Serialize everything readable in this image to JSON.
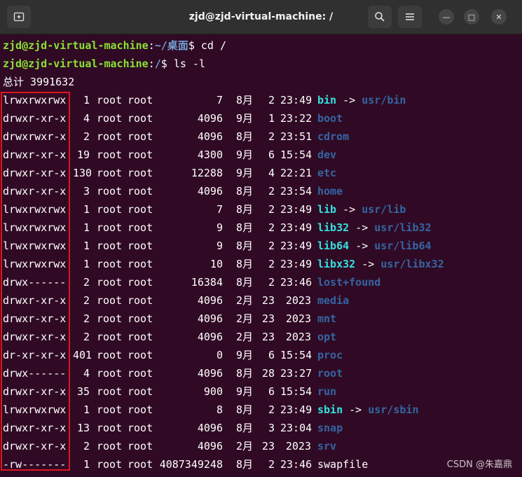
{
  "window": {
    "title": "zjd@zjd-virtual-machine: /",
    "new_tab_icon": "new-tab-icon",
    "search_icon": "search-icon",
    "menu_icon": "hamburger-menu-icon",
    "minimize_glyph": "—",
    "maximize_glyph": "□",
    "close_glyph": "✕"
  },
  "prompts": [
    {
      "user": "zjd@zjd-virtual-machine",
      "sep": ":",
      "path": "~/桌面",
      "dollar": "$ ",
      "command": "cd /"
    },
    {
      "user": "zjd@zjd-virtual-machine",
      "sep": ":",
      "path": "/",
      "dollar": "$ ",
      "command": "ls -l"
    }
  ],
  "total_line": "总计 3991632",
  "listing": [
    {
      "perm": "lrwxrwxrwx",
      "links": "1",
      "owner": "root",
      "group": "root",
      "size": "7",
      "month": "8月",
      "day": "2",
      "time": "23:49",
      "name": "bin",
      "kind": "link",
      "arrow": "->",
      "target": "usr/bin"
    },
    {
      "perm": "drwxr-xr-x",
      "links": "4",
      "owner": "root",
      "group": "root",
      "size": "4096",
      "month": "9月",
      "day": "1",
      "time": "23:22",
      "name": "boot",
      "kind": "dir"
    },
    {
      "perm": "drwxrwxr-x",
      "links": "2",
      "owner": "root",
      "group": "root",
      "size": "4096",
      "month": "8月",
      "day": "2",
      "time": "23:51",
      "name": "cdrom",
      "kind": "dir"
    },
    {
      "perm": "drwxr-xr-x",
      "links": "19",
      "owner": "root",
      "group": "root",
      "size": "4300",
      "month": "9月",
      "day": "6",
      "time": "15:54",
      "name": "dev",
      "kind": "dir"
    },
    {
      "perm": "drwxr-xr-x",
      "links": "130",
      "owner": "root",
      "group": "root",
      "size": "12288",
      "month": "9月",
      "day": "4",
      "time": "22:21",
      "name": "etc",
      "kind": "dir"
    },
    {
      "perm": "drwxr-xr-x",
      "links": "3",
      "owner": "root",
      "group": "root",
      "size": "4096",
      "month": "8月",
      "day": "2",
      "time": "23:54",
      "name": "home",
      "kind": "dir"
    },
    {
      "perm": "lrwxrwxrwx",
      "links": "1",
      "owner": "root",
      "group": "root",
      "size": "7",
      "month": "8月",
      "day": "2",
      "time": "23:49",
      "name": "lib",
      "kind": "link",
      "arrow": "->",
      "target": "usr/lib"
    },
    {
      "perm": "lrwxrwxrwx",
      "links": "1",
      "owner": "root",
      "group": "root",
      "size": "9",
      "month": "8月",
      "day": "2",
      "time": "23:49",
      "name": "lib32",
      "kind": "link",
      "arrow": "->",
      "target": "usr/lib32"
    },
    {
      "perm": "lrwxrwxrwx",
      "links": "1",
      "owner": "root",
      "group": "root",
      "size": "9",
      "month": "8月",
      "day": "2",
      "time": "23:49",
      "name": "lib64",
      "kind": "link",
      "arrow": "->",
      "target": "usr/lib64"
    },
    {
      "perm": "lrwxrwxrwx",
      "links": "1",
      "owner": "root",
      "group": "root",
      "size": "10",
      "month": "8月",
      "day": "2",
      "time": "23:49",
      "name": "libx32",
      "kind": "link",
      "arrow": "->",
      "target": "usr/libx32"
    },
    {
      "perm": "drwx------",
      "links": "2",
      "owner": "root",
      "group": "root",
      "size": "16384",
      "month": "8月",
      "day": "2",
      "time": "23:46",
      "name": "lost+found",
      "kind": "dir"
    },
    {
      "perm": "drwxr-xr-x",
      "links": "2",
      "owner": "root",
      "group": "root",
      "size": "4096",
      "month": "2月",
      "day": "23",
      "time": "2023",
      "name": "media",
      "kind": "dir"
    },
    {
      "perm": "drwxr-xr-x",
      "links": "2",
      "owner": "root",
      "group": "root",
      "size": "4096",
      "month": "2月",
      "day": "23",
      "time": "2023",
      "name": "mnt",
      "kind": "dir"
    },
    {
      "perm": "drwxr-xr-x",
      "links": "2",
      "owner": "root",
      "group": "root",
      "size": "4096",
      "month": "2月",
      "day": "23",
      "time": "2023",
      "name": "opt",
      "kind": "dir"
    },
    {
      "perm": "dr-xr-xr-x",
      "links": "401",
      "owner": "root",
      "group": "root",
      "size": "0",
      "month": "9月",
      "day": "6",
      "time": "15:54",
      "name": "proc",
      "kind": "dir"
    },
    {
      "perm": "drwx------",
      "links": "4",
      "owner": "root",
      "group": "root",
      "size": "4096",
      "month": "8月",
      "day": "28",
      "time": "23:27",
      "name": "root",
      "kind": "dir"
    },
    {
      "perm": "drwxr-xr-x",
      "links": "35",
      "owner": "root",
      "group": "root",
      "size": "900",
      "month": "9月",
      "day": "6",
      "time": "15:54",
      "name": "run",
      "kind": "dir"
    },
    {
      "perm": "lrwxrwxrwx",
      "links": "1",
      "owner": "root",
      "group": "root",
      "size": "8",
      "month": "8月",
      "day": "2",
      "time": "23:49",
      "name": "sbin",
      "kind": "link",
      "arrow": "->",
      "target": "usr/sbin"
    },
    {
      "perm": "drwxr-xr-x",
      "links": "13",
      "owner": "root",
      "group": "root",
      "size": "4096",
      "month": "8月",
      "day": "3",
      "time": "23:04",
      "name": "snap",
      "kind": "dir"
    },
    {
      "perm": "drwxr-xr-x",
      "links": "2",
      "owner": "root",
      "group": "root",
      "size": "4096",
      "month": "2月",
      "day": "23",
      "time": "2023",
      "name": "srv",
      "kind": "dir"
    },
    {
      "perm": "-rw-------",
      "links": "1",
      "owner": "root",
      "group": "root",
      "size": "4087349248",
      "month": "8月",
      "day": "2",
      "time": "23:46",
      "name": "swapfile",
      "kind": "file"
    }
  ],
  "watermark": "CSDN @朱嘉鼎",
  "colors": {
    "background": "#300a24",
    "user": "#8ae234",
    "path": "#729fcf",
    "directory": "#3465a4",
    "symlink": "#34e2e2",
    "highlight_box": "#e0141e"
  }
}
